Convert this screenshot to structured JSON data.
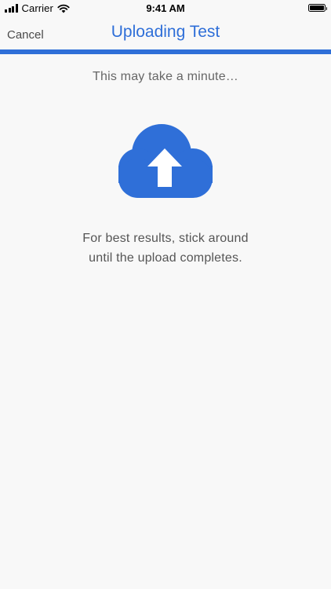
{
  "status_bar": {
    "carrier": "Carrier",
    "time": "9:41 AM",
    "icons": [
      "signal-icon",
      "wifi-icon",
      "battery-icon"
    ]
  },
  "nav": {
    "cancel_label": "Cancel",
    "title": "Uploading Test"
  },
  "upload": {
    "progress_percent": 100,
    "subtitle": "This may take a minute…",
    "icon": "cloud-upload-icon",
    "message_line1": "For best results, stick around",
    "message_line2": "until the upload completes."
  },
  "colors": {
    "accent": "#2f6fd8",
    "background": "#f8f8f8",
    "text_secondary": "#666666"
  }
}
